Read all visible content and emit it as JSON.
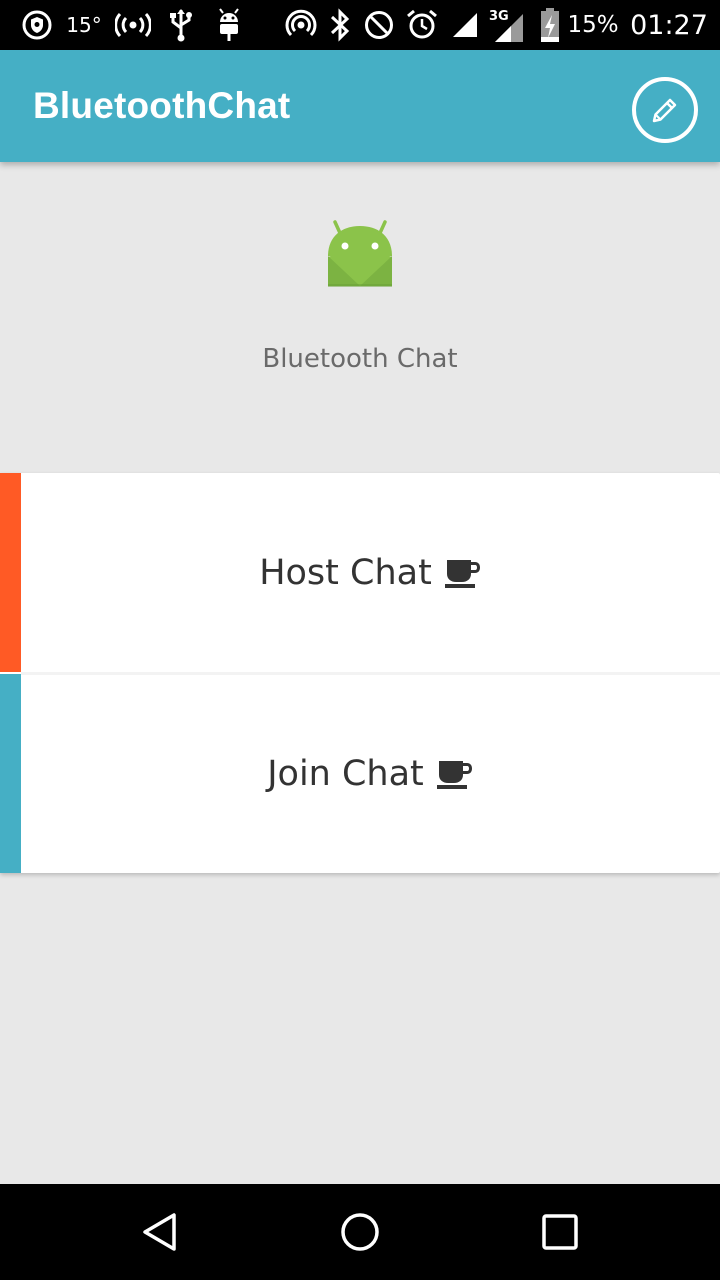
{
  "status_bar": {
    "temperature": "15°",
    "battery_percent": "15%",
    "time": "01:27",
    "network_type": "3G",
    "icons": [
      "vpn-shield-icon",
      "radio-waves-icon",
      "usb-icon",
      "android-debug-icon",
      "hotspot-icon",
      "bluetooth-icon",
      "do-not-disturb-icon",
      "alarm-icon",
      "signal-icon",
      "mobile-signal-icon",
      "battery-charging-icon"
    ]
  },
  "app_bar": {
    "title": "BluetoothChat",
    "action_icon": "edit-pencil-icon",
    "color": "#45afc5"
  },
  "header": {
    "logo_icon": "android-logo-icon",
    "caption": "Bluetooth Chat"
  },
  "menu": {
    "items": [
      {
        "label": "Host Chat",
        "icon": "coffee-cup-icon",
        "accent": "#ff5a25"
      },
      {
        "label": "Join Chat",
        "icon": "coffee-cup-icon",
        "accent": "#45afc5"
      }
    ]
  },
  "nav_bar": {
    "buttons": [
      "back-icon",
      "home-icon",
      "recents-icon"
    ]
  }
}
